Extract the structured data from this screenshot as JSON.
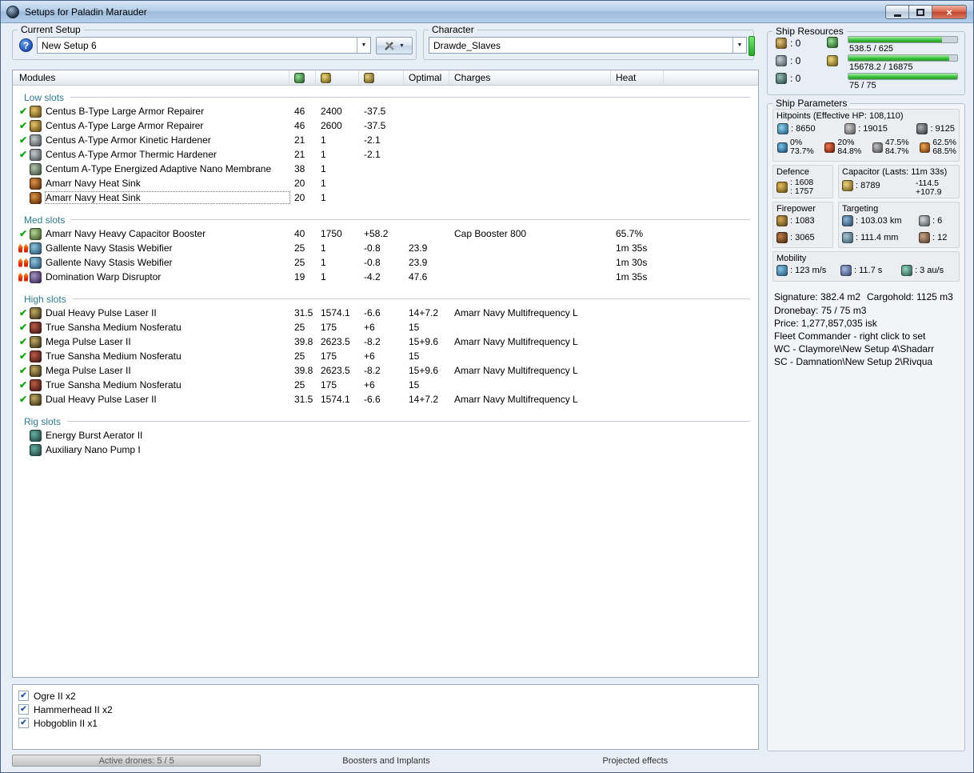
{
  "window": {
    "title": "Setups for Paladin Marauder"
  },
  "setup_bar": {
    "current_setup_label": "Current Setup",
    "current_setup_value": "New Setup 6",
    "character_label": "Character",
    "character_value": "Drawde_Slaves"
  },
  "ship_resources": {
    "title": "Ship Resources",
    "turret_slots": ": 0",
    "launcher_slots": ": 0",
    "rig_slots": ": 0",
    "cpu": {
      "text": "538.5 / 625",
      "pct": 86
    },
    "powergrid": {
      "text": "15678.2 / 16875",
      "pct": 93
    },
    "calibration": {
      "text": "75 / 75",
      "pct": 100
    }
  },
  "modules": {
    "columns": {
      "modules": "Modules",
      "optimal": "Optimal",
      "charges": "Charges",
      "heat": "Heat"
    },
    "sections": [
      {
        "name": "Low slots",
        "rows": [
          {
            "status": "on",
            "icon": "repairer",
            "name": "Centus B-Type Large Armor Repairer",
            "cpu": "46",
            "pg": "2400",
            "cap": "-37.5",
            "optimal": "",
            "charges": "",
            "heat": ""
          },
          {
            "status": "on",
            "icon": "repairer",
            "name": "Centus A-Type Large Armor Repairer",
            "cpu": "46",
            "pg": "2600",
            "cap": "-37.5",
            "optimal": "",
            "charges": "",
            "heat": ""
          },
          {
            "status": "on",
            "icon": "hardener",
            "name": "Centus A-Type Armor Kinetic Hardener",
            "cpu": "21",
            "pg": "1",
            "cap": "-2.1",
            "optimal": "",
            "charges": "",
            "heat": ""
          },
          {
            "status": "on",
            "icon": "hardener",
            "name": "Centus A-Type Armor Thermic Hardener",
            "cpu": "21",
            "pg": "1",
            "cap": "-2.1",
            "optimal": "",
            "charges": "",
            "heat": ""
          },
          {
            "status": "none",
            "icon": "membrane",
            "name": "Centum A-Type Energized Adaptive Nano Membrane",
            "cpu": "38",
            "pg": "1",
            "cap": "",
            "optimal": "",
            "charges": "",
            "heat": ""
          },
          {
            "status": "none",
            "icon": "heatsink",
            "name": "Amarr Navy Heat Sink",
            "cpu": "20",
            "pg": "1",
            "cap": "",
            "optimal": "",
            "charges": "",
            "heat": ""
          },
          {
            "status": "none",
            "icon": "heatsink",
            "name": "Amarr Navy Heat Sink",
            "cpu": "20",
            "pg": "1",
            "cap": "",
            "optimal": "",
            "charges": "",
            "heat": "",
            "selected": true
          }
        ]
      },
      {
        "name": "Med slots",
        "rows": [
          {
            "status": "on",
            "icon": "capbooster",
            "name": "Amarr Navy Heavy Capacitor Booster",
            "cpu": "40",
            "pg": "1750",
            "cap": "+58.2",
            "optimal": "",
            "charges": "Cap Booster 800",
            "heat": "65.7%"
          },
          {
            "status": "overheat",
            "icon": "webifier",
            "name": "Gallente Navy Stasis Webifier",
            "cpu": "25",
            "pg": "1",
            "cap": "-0.8",
            "optimal": "23.9",
            "charges": "",
            "heat": "1m 35s"
          },
          {
            "status": "overheat",
            "icon": "webifier",
            "name": "Gallente Navy Stasis Webifier",
            "cpu": "25",
            "pg": "1",
            "cap": "-0.8",
            "optimal": "23.9",
            "charges": "",
            "heat": "1m 30s"
          },
          {
            "status": "overheat",
            "icon": "disruptor",
            "name": "Domination Warp Disruptor",
            "cpu": "19",
            "pg": "1",
            "cap": "-4.2",
            "optimal": "47.6",
            "charges": "",
            "heat": "1m 35s"
          }
        ]
      },
      {
        "name": "High slots",
        "rows": [
          {
            "status": "on",
            "icon": "laser",
            "name": "Dual Heavy Pulse Laser II",
            "cpu": "31.5",
            "pg": "1574.1",
            "cap": "-6.6",
            "optimal": "14+7.2",
            "charges": "Amarr Navy Multifrequency L",
            "heat": ""
          },
          {
            "status": "on",
            "icon": "nosferatu",
            "name": "True Sansha Medium Nosferatu",
            "cpu": "25",
            "pg": "175",
            "cap": "+6",
            "optimal": "15",
            "charges": "",
            "heat": ""
          },
          {
            "status": "on",
            "icon": "laser",
            "name": "Mega Pulse Laser II",
            "cpu": "39.8",
            "pg": "2623.5",
            "cap": "-8.2",
            "optimal": "15+9.6",
            "charges": "Amarr Navy Multifrequency L",
            "heat": ""
          },
          {
            "status": "on",
            "icon": "nosferatu",
            "name": "True Sansha Medium Nosferatu",
            "cpu": "25",
            "pg": "175",
            "cap": "+6",
            "optimal": "15",
            "charges": "",
            "heat": ""
          },
          {
            "status": "on",
            "icon": "laser",
            "name": "Mega Pulse Laser II",
            "cpu": "39.8",
            "pg": "2623.5",
            "cap": "-8.2",
            "optimal": "15+9.6",
            "charges": "Amarr Navy Multifrequency L",
            "heat": ""
          },
          {
            "status": "on",
            "icon": "nosferatu",
            "name": "True Sansha Medium Nosferatu",
            "cpu": "25",
            "pg": "175",
            "cap": "+6",
            "optimal": "15",
            "charges": "",
            "heat": ""
          },
          {
            "status": "on",
            "icon": "laser",
            "name": "Dual Heavy Pulse Laser II",
            "cpu": "31.5",
            "pg": "1574.1",
            "cap": "-6.6",
            "optimal": "14+7.2",
            "charges": "Amarr Navy Multifrequency L",
            "heat": ""
          }
        ]
      },
      {
        "name": "Rig slots",
        "rows": [
          {
            "status": "none",
            "icon": "rig",
            "name": "Energy Burst Aerator II",
            "cpu": "",
            "pg": "",
            "cap": "",
            "optimal": "",
            "charges": "",
            "heat": ""
          },
          {
            "status": "none",
            "icon": "rig",
            "name": "Auxiliary Nano Pump I",
            "cpu": "",
            "pg": "",
            "cap": "",
            "optimal": "",
            "charges": "",
            "heat": ""
          }
        ]
      }
    ]
  },
  "drones": [
    {
      "checked": true,
      "name": "Ogre II x2"
    },
    {
      "checked": true,
      "name": "Hammerhead II x2"
    },
    {
      "checked": true,
      "name": "Hobgoblin II x1"
    }
  ],
  "bottom_bar": {
    "active_drones": "Active drones: 5 / 5",
    "boosters": "Boosters and Implants",
    "projected": "Projected effects"
  },
  "ship_parameters": {
    "title": "Ship Parameters",
    "hitpoints": {
      "title": "Hitpoints (Effective HP: 108,110)",
      "shield": ": 8650",
      "armor": ": 19015",
      "hull": ": 9125",
      "resists": [
        {
          "value": "0%",
          "pct": "73.7%"
        },
        {
          "value": "20%",
          "pct": "84.8%"
        },
        {
          "value": "47.5%",
          "pct": "84.7%"
        },
        {
          "value": "62.5%",
          "pct": "68.5%"
        }
      ]
    },
    "defence": {
      "title": "Defence",
      "line1": ": 1608",
      "line2": ": 1757"
    },
    "capacitor": {
      "title": "Capacitor (Lasts: 11m 33s)",
      "amount": ": 8789",
      "out": "-114.5",
      "in": "+107.9"
    },
    "firepower": {
      "title": "Firepower",
      "dps": ": 1083",
      "volley": ": 3065"
    },
    "targeting": {
      "title": "Targeting",
      "range": ": 103.03 km",
      "max_targets": ": 6",
      "scan_res": ": 111.4 mm",
      "locked": ": 12"
    },
    "mobility": {
      "title": "Mobility",
      "speed": ": 123 m/s",
      "align": ": 11.7 s",
      "warp": ": 3 au/s"
    },
    "signature": "Signature: 382.4 m2",
    "cargohold": "Cargohold: 1125 m3",
    "dronebay": "Dronebay: 75 / 75 m3",
    "price": "Price: 1,277,857,035 isk",
    "fleet_commander": "Fleet Commander - right click to set",
    "wc": "WC - Claymore\\New Setup 4\\Shadarr",
    "sc": "SC - Damnation\\New Setup 2\\Rivqua"
  },
  "colors": {
    "resource_bar_fill": "#3cc03c",
    "section_header_text": "#2f7a8f",
    "active_check": "#16a316",
    "overheat_flame": "#d32600",
    "character_indicator": "#3cd43c",
    "close_button": "#c24630"
  }
}
